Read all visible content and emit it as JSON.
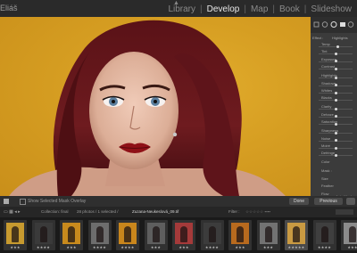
{
  "app": {
    "brand": "Eliáš"
  },
  "modules": {
    "library": "Library",
    "develop": "Develop",
    "map": "Map",
    "book": "Book",
    "slideshow": "Slideshow",
    "active": "Develop"
  },
  "toolbar": {
    "show_overlay": "Show Selected Mask Overlay",
    "done": "Done",
    "previous": "Previous"
  },
  "filmstrip": {
    "collection": "Collection: final",
    "count": "28 photos / 1 selected /",
    "selected_file": "Zuzana-Neukeslová_09.tif",
    "filter": "Filter :"
  },
  "panel": {
    "effect": "Effect :",
    "highlights": "Highlights",
    "labels": [
      "Temp",
      "Tint",
      "Exposure",
      "Contrast",
      "Highlights",
      "Shadows",
      "Whites",
      "Blacks",
      "Clarity",
      "Dehaze",
      "Saturation",
      "Sharpness",
      "Noise",
      "Moiré",
      "Defringe",
      "Color",
      "Mask :",
      "Size",
      "Feather",
      "Flow",
      "Density"
    ],
    "auto_mask": "Auto Mask",
    "values": [
      0.55,
      0.5,
      0.5,
      0.5,
      0.5,
      0.5,
      0.5,
      0.5,
      0.5,
      0.5,
      0.5,
      0.5,
      0.5,
      0.5,
      0.5
    ]
  },
  "thumbnails": [
    {
      "tone": "#c79a2f",
      "stars": "★★★"
    },
    {
      "tone": "#3a3a3a",
      "stars": "★★★★"
    },
    {
      "tone": "#c88a1d",
      "stars": "★★★"
    },
    {
      "tone": "#6d6d6d",
      "stars": "★★★★"
    },
    {
      "tone": "#c9861c",
      "stars": "★★★★"
    },
    {
      "tone": "#5e5e5e",
      "stars": "★★★"
    },
    {
      "tone": "#a43a3a",
      "stars": "★★★"
    },
    {
      "tone": "#3c3c3c",
      "stars": "★★★★"
    },
    {
      "tone": "#b86a1e",
      "stars": "★★★"
    },
    {
      "tone": "#727272",
      "stars": "★★★"
    },
    {
      "tone": "#c99a42",
      "stars": "★★★★★"
    },
    {
      "tone": "#3f3f3f",
      "stars": "★★★★"
    },
    {
      "tone": "#8b8b8b",
      "stars": "★★★"
    }
  ],
  "colors": {
    "background": "#d9a124",
    "hair": "#5d1419",
    "skin": "#e7c1ad",
    "lips": "#8f1117"
  }
}
